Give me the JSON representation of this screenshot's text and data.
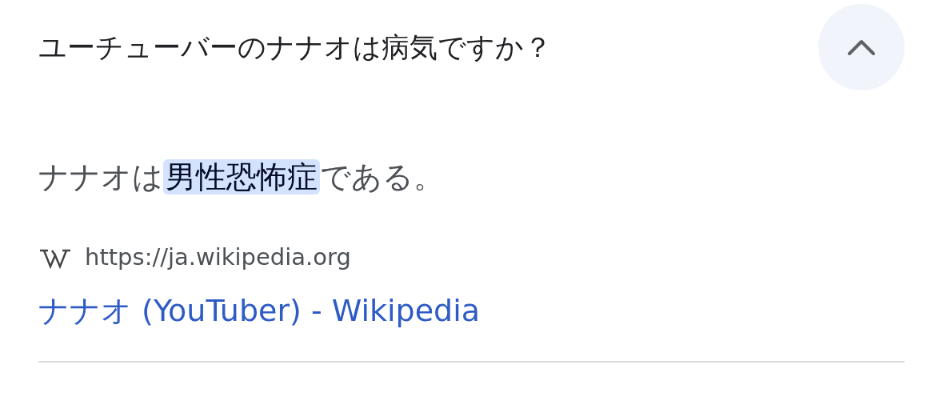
{
  "question": {
    "text": "ユーチューバーのナナオは病気ですか？",
    "expanded": true
  },
  "answer": [
    {
      "text": "ナナオは",
      "highlighted": false
    },
    {
      "text": "男性恐怖症",
      "highlighted": true
    },
    {
      "text": "である。",
      "highlighted": false
    }
  ],
  "source": {
    "url": "https://ja.wikipedia.org",
    "title": "ナナオ (YouTuber) - Wikipedia"
  }
}
